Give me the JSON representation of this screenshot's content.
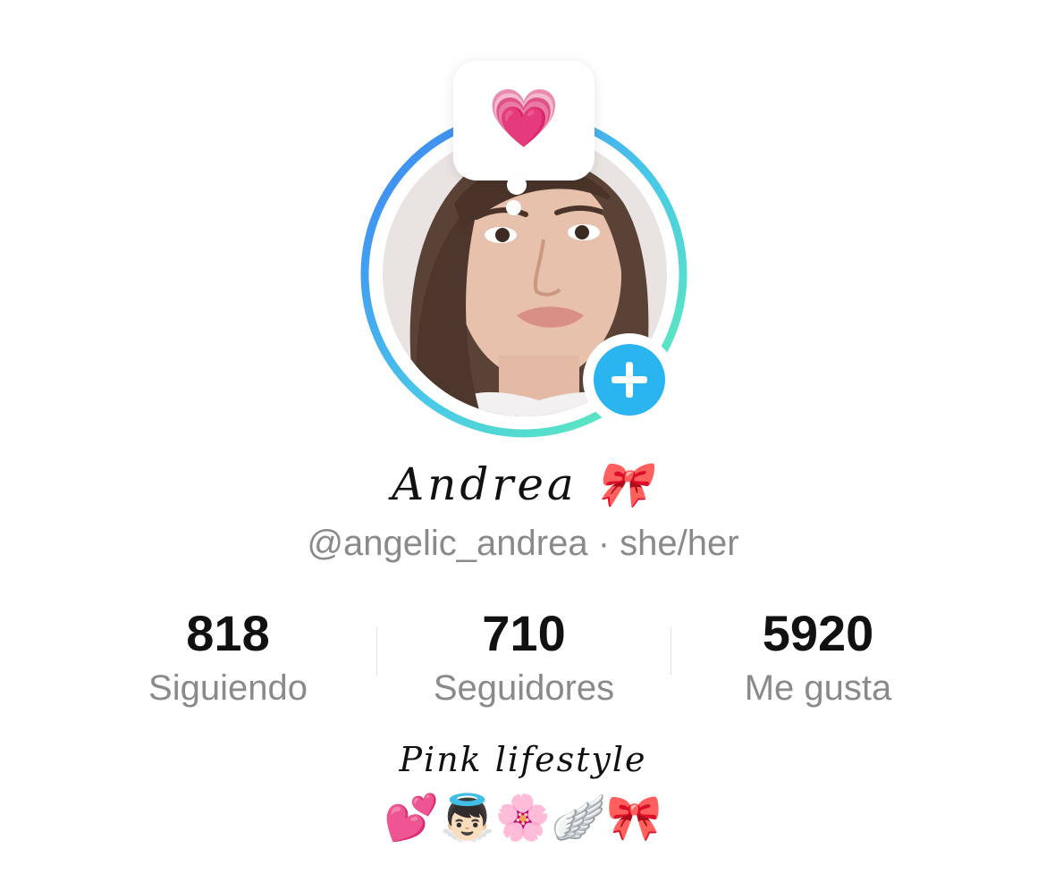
{
  "note": {
    "emoji": "💗"
  },
  "profile": {
    "display_name": "Andrea 🎀",
    "handle_line": "@angelic_andrea · she/her",
    "avatar_icon": "avatar-photo",
    "add_icon": "plus-icon"
  },
  "stats": [
    {
      "value": "818",
      "label": "Siguiendo"
    },
    {
      "value": "710",
      "label": "Seguidores"
    },
    {
      "value": "5920",
      "label": "Me gusta"
    }
  ],
  "bio": {
    "title": "Pink lifestyle",
    "emojis": "💕👼🏻🌸🪽🎀"
  },
  "colors": {
    "ring_start": "#3d8ef5",
    "ring_end": "#5ef0b6",
    "add_button": "#2ab4f0",
    "text_primary": "#111111",
    "text_secondary": "#8a8a8a"
  }
}
